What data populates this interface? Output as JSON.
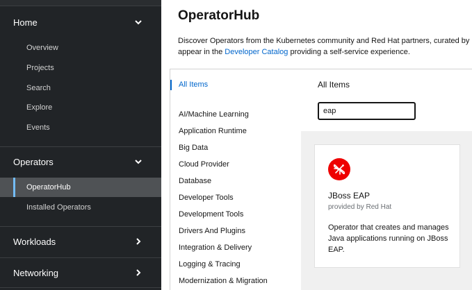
{
  "sidebar": {
    "sections": [
      {
        "label": "Home",
        "expanded": true,
        "items": [
          "Overview",
          "Projects",
          "Search",
          "Explore",
          "Events"
        ]
      },
      {
        "label": "Operators",
        "expanded": true,
        "items": [
          "OperatorHub",
          "Installed Operators"
        ],
        "active": "OperatorHub"
      },
      {
        "label": "Workloads",
        "expanded": false
      },
      {
        "label": "Networking",
        "expanded": false
      }
    ]
  },
  "page": {
    "title": "OperatorHub",
    "desc_line1": "Discover Operators from the Kubernetes community and Red Hat partners, curated by",
    "desc_pre": "appear in the ",
    "desc_link": "Developer Catalog",
    "desc_post": " providing a self-service experience."
  },
  "categories": {
    "all": "All Items",
    "list": [
      "AI/Machine Learning",
      "Application Runtime",
      "Big Data",
      "Cloud Provider",
      "Database",
      "Developer Tools",
      "Development Tools",
      "Drivers And Plugins",
      "Integration & Delivery",
      "Logging & Tracing",
      "Modernization & Migration"
    ]
  },
  "items": {
    "heading": "All Items",
    "search_value": "eap"
  },
  "tile": {
    "icon": "jboss-dragonfly-icon",
    "name": "JBoss EAP",
    "provider": "provided by Red Hat",
    "description": "Operator that creates and manages Java applications running on JBoss EAP."
  },
  "colors": {
    "sidebar_bg": "#212427",
    "link": "#0066cc",
    "brand_red": "#ee0000",
    "active_accent": "#73bcf7"
  }
}
